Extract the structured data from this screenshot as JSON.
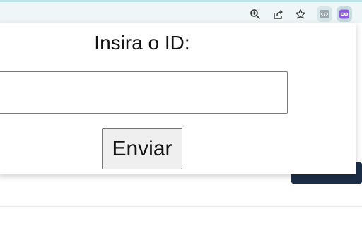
{
  "browser": {
    "toolbar_icons": [
      "zoom-icon",
      "share-icon",
      "star-icon"
    ],
    "extensions": [
      "devtools-extension-icon",
      "infinity-extension-icon"
    ],
    "accent_color": "#bfe6e8"
  },
  "popup": {
    "title": "Insira o ID:",
    "input": {
      "value": "",
      "placeholder": ""
    },
    "submit_label": "Enviar"
  },
  "colors": {
    "dark_block": "#1c2e47",
    "extension_active": "#c7dcdf"
  }
}
